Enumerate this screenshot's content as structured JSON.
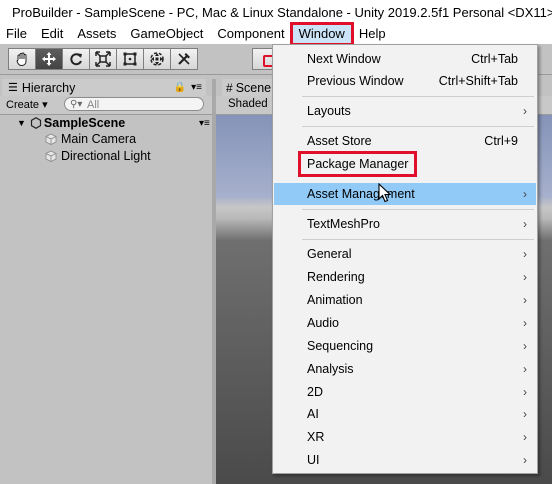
{
  "window": {
    "title": "ProBuilder - SampleScene - PC, Mac & Linux Standalone - Unity 2019.2.5f1 Personal <DX11>"
  },
  "menubar": {
    "items": [
      {
        "label": "File"
      },
      {
        "label": "Edit"
      },
      {
        "label": "Assets"
      },
      {
        "label": "GameObject"
      },
      {
        "label": "Component"
      },
      {
        "label": "Window"
      },
      {
        "label": "Help"
      }
    ],
    "active": "Window"
  },
  "toolbar": {
    "tools": [
      "hand-tool",
      "move-tool",
      "rotate-tool",
      "scale-tool",
      "rect-tool",
      "transform-tool",
      "custom-tool"
    ],
    "selected": "move-tool"
  },
  "hierarchy": {
    "tab_label": "Hierarchy",
    "create_label": "Create ▾",
    "search_placeholder": "All",
    "scene_name": "SampleScene",
    "objects": [
      "Main Camera",
      "Directional Light"
    ]
  },
  "scene": {
    "tab_label": "Scene",
    "shading_mode": "Shaded"
  },
  "window_menu": {
    "items": [
      {
        "label": "Next Window",
        "shortcut": "Ctrl+Tab",
        "submenu": false
      },
      {
        "label": "Previous Window",
        "shortcut": "Ctrl+Shift+Tab",
        "submenu": false
      },
      {
        "label": "Layouts",
        "shortcut": "",
        "submenu": true
      },
      {
        "label": "Asset Store",
        "shortcut": "Ctrl+9",
        "submenu": false
      },
      {
        "label": "Package Manager",
        "shortcut": "",
        "submenu": false,
        "highlighted_box": true
      },
      {
        "label": "Asset Management",
        "shortcut": "",
        "submenu": true,
        "hover": true
      },
      {
        "label": "TextMeshPro",
        "shortcut": "",
        "submenu": true
      },
      {
        "label": "General",
        "shortcut": "",
        "submenu": true
      },
      {
        "label": "Rendering",
        "shortcut": "",
        "submenu": true
      },
      {
        "label": "Animation",
        "shortcut": "",
        "submenu": true
      },
      {
        "label": "Audio",
        "shortcut": "",
        "submenu": true
      },
      {
        "label": "Sequencing",
        "shortcut": "",
        "submenu": true
      },
      {
        "label": "Analysis",
        "shortcut": "",
        "submenu": true
      },
      {
        "label": "2D",
        "shortcut": "",
        "submenu": true
      },
      {
        "label": "AI",
        "shortcut": "",
        "submenu": true
      },
      {
        "label": "XR",
        "shortcut": "",
        "submenu": true
      },
      {
        "label": "UI",
        "shortcut": "",
        "submenu": true
      }
    ]
  },
  "colors": {
    "highlight": "#91c9f7",
    "annotation_red": "#e0102a",
    "menu_bg": "#f2f2f2",
    "editor_bg": "#c2c2c2"
  }
}
